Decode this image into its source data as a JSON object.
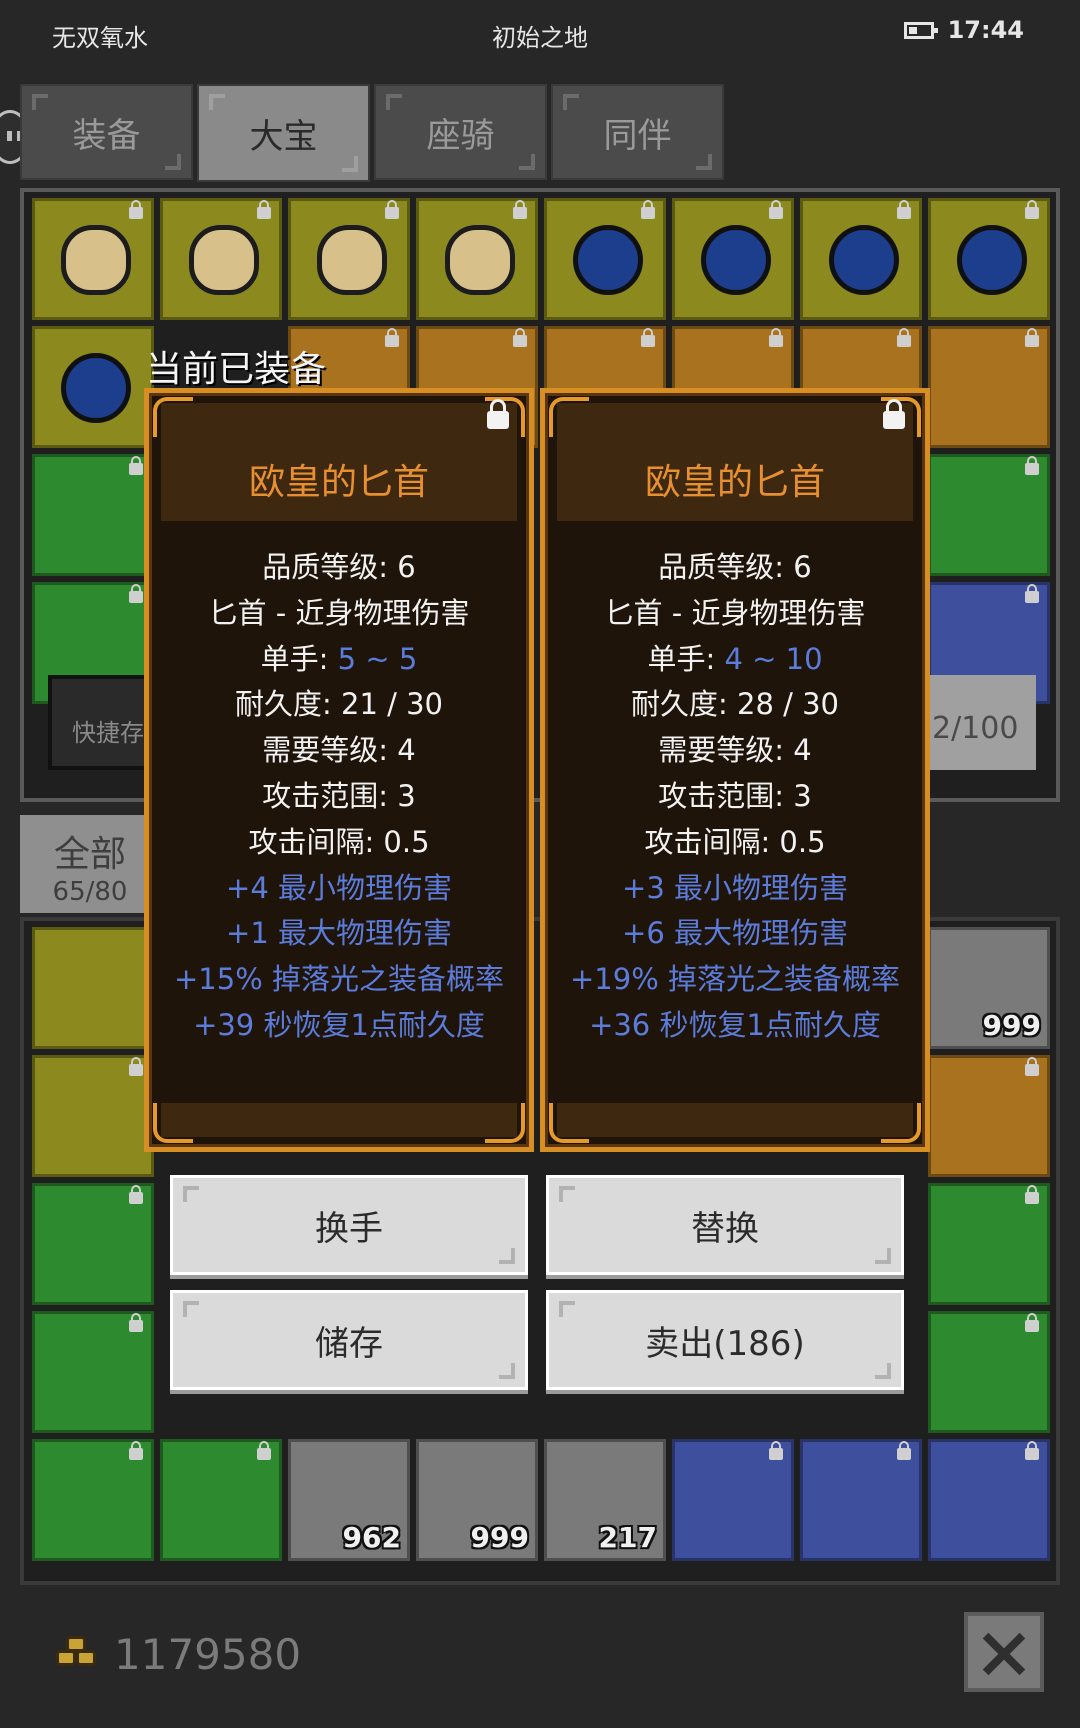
{
  "status_bar": {
    "left": "无双氧水",
    "center": "初始之地",
    "time": "17:44"
  },
  "tabs": [
    {
      "label": "装备"
    },
    {
      "label": "大宝"
    },
    {
      "label": "座骑"
    },
    {
      "label": "同伴"
    }
  ],
  "active_tab": "大宝",
  "quick_store_label": "快捷存",
  "storage_capacity": "2/100",
  "filter": {
    "label": "全部",
    "count": "65/80"
  },
  "equipped_label": "当前已装备",
  "cards": [
    {
      "title": "欧皇的匕首",
      "quality": "品质等级: 6",
      "type": "匕首 - 近身物理伤害",
      "hand_label": "单手: ",
      "hand_value": "5 ~ 5",
      "durability": "耐久度: 21 / 30",
      "req_level": "需要等级: 4",
      "range": "攻击范围: 3",
      "interval": "攻击间隔: 0.5",
      "bonus": [
        "+4 最小物理伤害",
        "+1 最大物理伤害",
        "+15% 掉落光之装备概率",
        "+39 秒恢复1点耐久度"
      ]
    },
    {
      "title": "欧皇的匕首",
      "quality": "品质等级: 6",
      "type": "匕首 - 近身物理伤害",
      "hand_label": "单手: ",
      "hand_value": "4 ~ 10",
      "durability": "耐久度: 28 / 30",
      "req_level": "需要等级: 4",
      "range": "攻击范围: 3",
      "interval": "攻击间隔: 0.5",
      "bonus": [
        "+3 最小物理伤害",
        "+6 最大物理伤害",
        "+19% 掉落光之装备概率",
        "+36 秒恢复1点耐久度"
      ]
    }
  ],
  "buttons": {
    "swap_hand": "换手",
    "replace": "替换",
    "store": "储存",
    "sell": "卖出(186)"
  },
  "item_counts": {
    "cake": "999",
    "fish": "962",
    "meat1": "999",
    "meat2": "217"
  },
  "gold": "1179580",
  "colors": {
    "card_border": "#d78e22",
    "title_orange": "#e89030",
    "bonus_blue": "#5b7cdb"
  }
}
